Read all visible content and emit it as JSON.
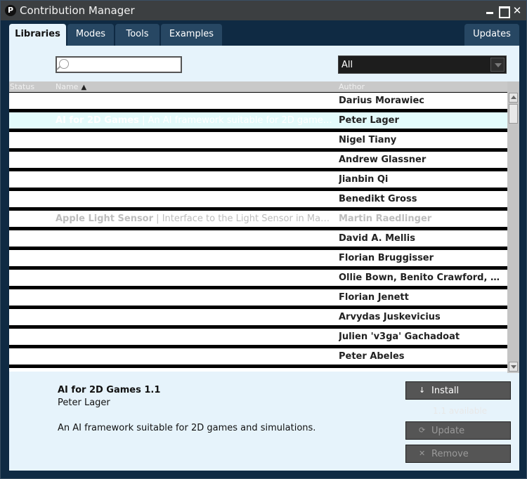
{
  "window": {
    "title": "Contribution Manager"
  },
  "tabs": [
    {
      "label": "Libraries",
      "active": true
    },
    {
      "label": "Modes"
    },
    {
      "label": "Tools"
    },
    {
      "label": "Examples"
    },
    {
      "label": "Updates"
    }
  ],
  "filter": {
    "search_value": "",
    "category_selected": "All"
  },
  "list_header": {
    "status": "Status",
    "name": "Name",
    "author": "Author"
  },
  "rows": [
    {
      "name": "",
      "description": "",
      "author": "Darius Morawiec"
    },
    {
      "name": "AI for 2D Games",
      "description": "An AI framework suitable for 2D games and simulations.",
      "author": "Peter Lager",
      "selected": true
    },
    {
      "name": "",
      "description": "",
      "author": "Nigel Tiany"
    },
    {
      "name": "",
      "description": "",
      "author": "Andrew Glassner"
    },
    {
      "name": "",
      "description": "",
      "author": "Jianbin Qi"
    },
    {
      "name": "",
      "description": "",
      "author": "Benedikt Gross"
    },
    {
      "name": "Apple Light Sensor",
      "description": "Interface to the Light Sensor in MacBook Pr...",
      "author": "Martin Raedlinger",
      "dim": true
    },
    {
      "name": "",
      "description": "",
      "author": "David A. Mellis"
    },
    {
      "name": "",
      "description": "",
      "author": "Florian Bruggisser"
    },
    {
      "name": "",
      "description": "",
      "author": "Ollie Bown, Benito Crawford, Ben Por..."
    },
    {
      "name": "",
      "description": "",
      "author": "Florian Jenett"
    },
    {
      "name": "",
      "description": "",
      "author": "Arvydas Juskevicius"
    },
    {
      "name": "",
      "description": "",
      "author": "Julien 'v3ga' Gachadoat"
    },
    {
      "name": "",
      "description": "",
      "author": "Peter Abeles"
    }
  ],
  "details": {
    "title": "AI for 2D Games 1.1",
    "author": "Peter Lager",
    "description": "An AI framework suitable for 2D games and simulations.",
    "availability": "1.1 available",
    "install_label": "Install",
    "update_label": "Update",
    "remove_label": "Remove"
  },
  "colors": {
    "window_bg": "#0f2a43",
    "tab_bg": "#274763",
    "tab_active_bg": "#e6f3fb",
    "selected_row_bg": "#e3fbfb",
    "button_bg": "#555555"
  }
}
